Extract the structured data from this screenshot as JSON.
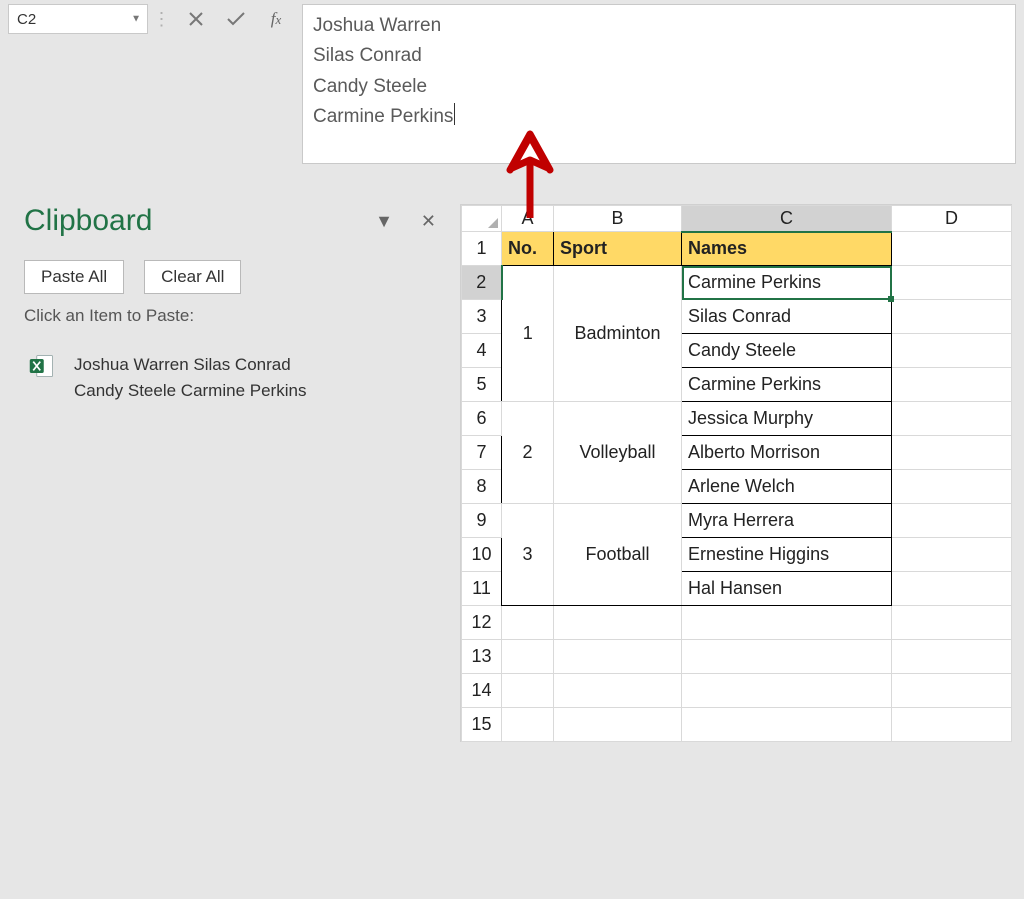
{
  "namebox": "C2",
  "formula_lines": [
    "Joshua Warren",
    "Silas Conrad",
    "Candy Steele",
    "Carmine Perkins"
  ],
  "clipboard": {
    "title": "Clipboard",
    "paste_all": "Paste All",
    "clear_all": "Clear All",
    "hint": "Click an Item to Paste:",
    "item_line1": "Joshua Warren Silas Conrad",
    "item_line2": "Candy Steele Carmine Perkins"
  },
  "columns": [
    "A",
    "B",
    "C",
    "D"
  ],
  "header": {
    "no": "No.",
    "sport": "Sport",
    "names": "Names"
  },
  "groups": [
    {
      "no": "1",
      "sport": "Badminton",
      "names": [
        "Carmine Perkins",
        "Silas Conrad",
        "Candy Steele",
        "Carmine Perkins"
      ]
    },
    {
      "no": "2",
      "sport": "Volleyball",
      "names": [
        "Jessica Murphy",
        "Alberto Morrison",
        "Arlene Welch"
      ]
    },
    {
      "no": "3",
      "sport": "Football",
      "names": [
        "Myra Herrera",
        "Ernestine Higgins",
        "Hal Hansen"
      ]
    }
  ],
  "extra_rows": [
    "12",
    "13",
    "14",
    "15"
  ]
}
